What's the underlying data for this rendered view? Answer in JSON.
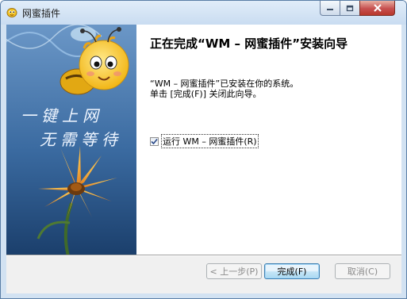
{
  "window": {
    "title": "网蜜插件"
  },
  "banner": {
    "line1": "一键上网",
    "line2": "无需等待"
  },
  "content": {
    "heading": "正在完成“WM – 网蜜插件”安装向导",
    "desc_line1": "“WM – 网蜜插件”已安装在你的系统。",
    "desc_line2": "单击 [完成(F)] 关闭此向导。",
    "run_checkbox_label": "运行 WM – 网蜜插件(R)",
    "run_checked": true
  },
  "buttons": {
    "back": "< 上一步(P)",
    "finish": "完成(F)",
    "cancel": "取消(C)"
  },
  "colors": {
    "banner_top": "#5f8cbf",
    "banner_bottom": "#1d4474",
    "accent": "#3c7fb1"
  }
}
